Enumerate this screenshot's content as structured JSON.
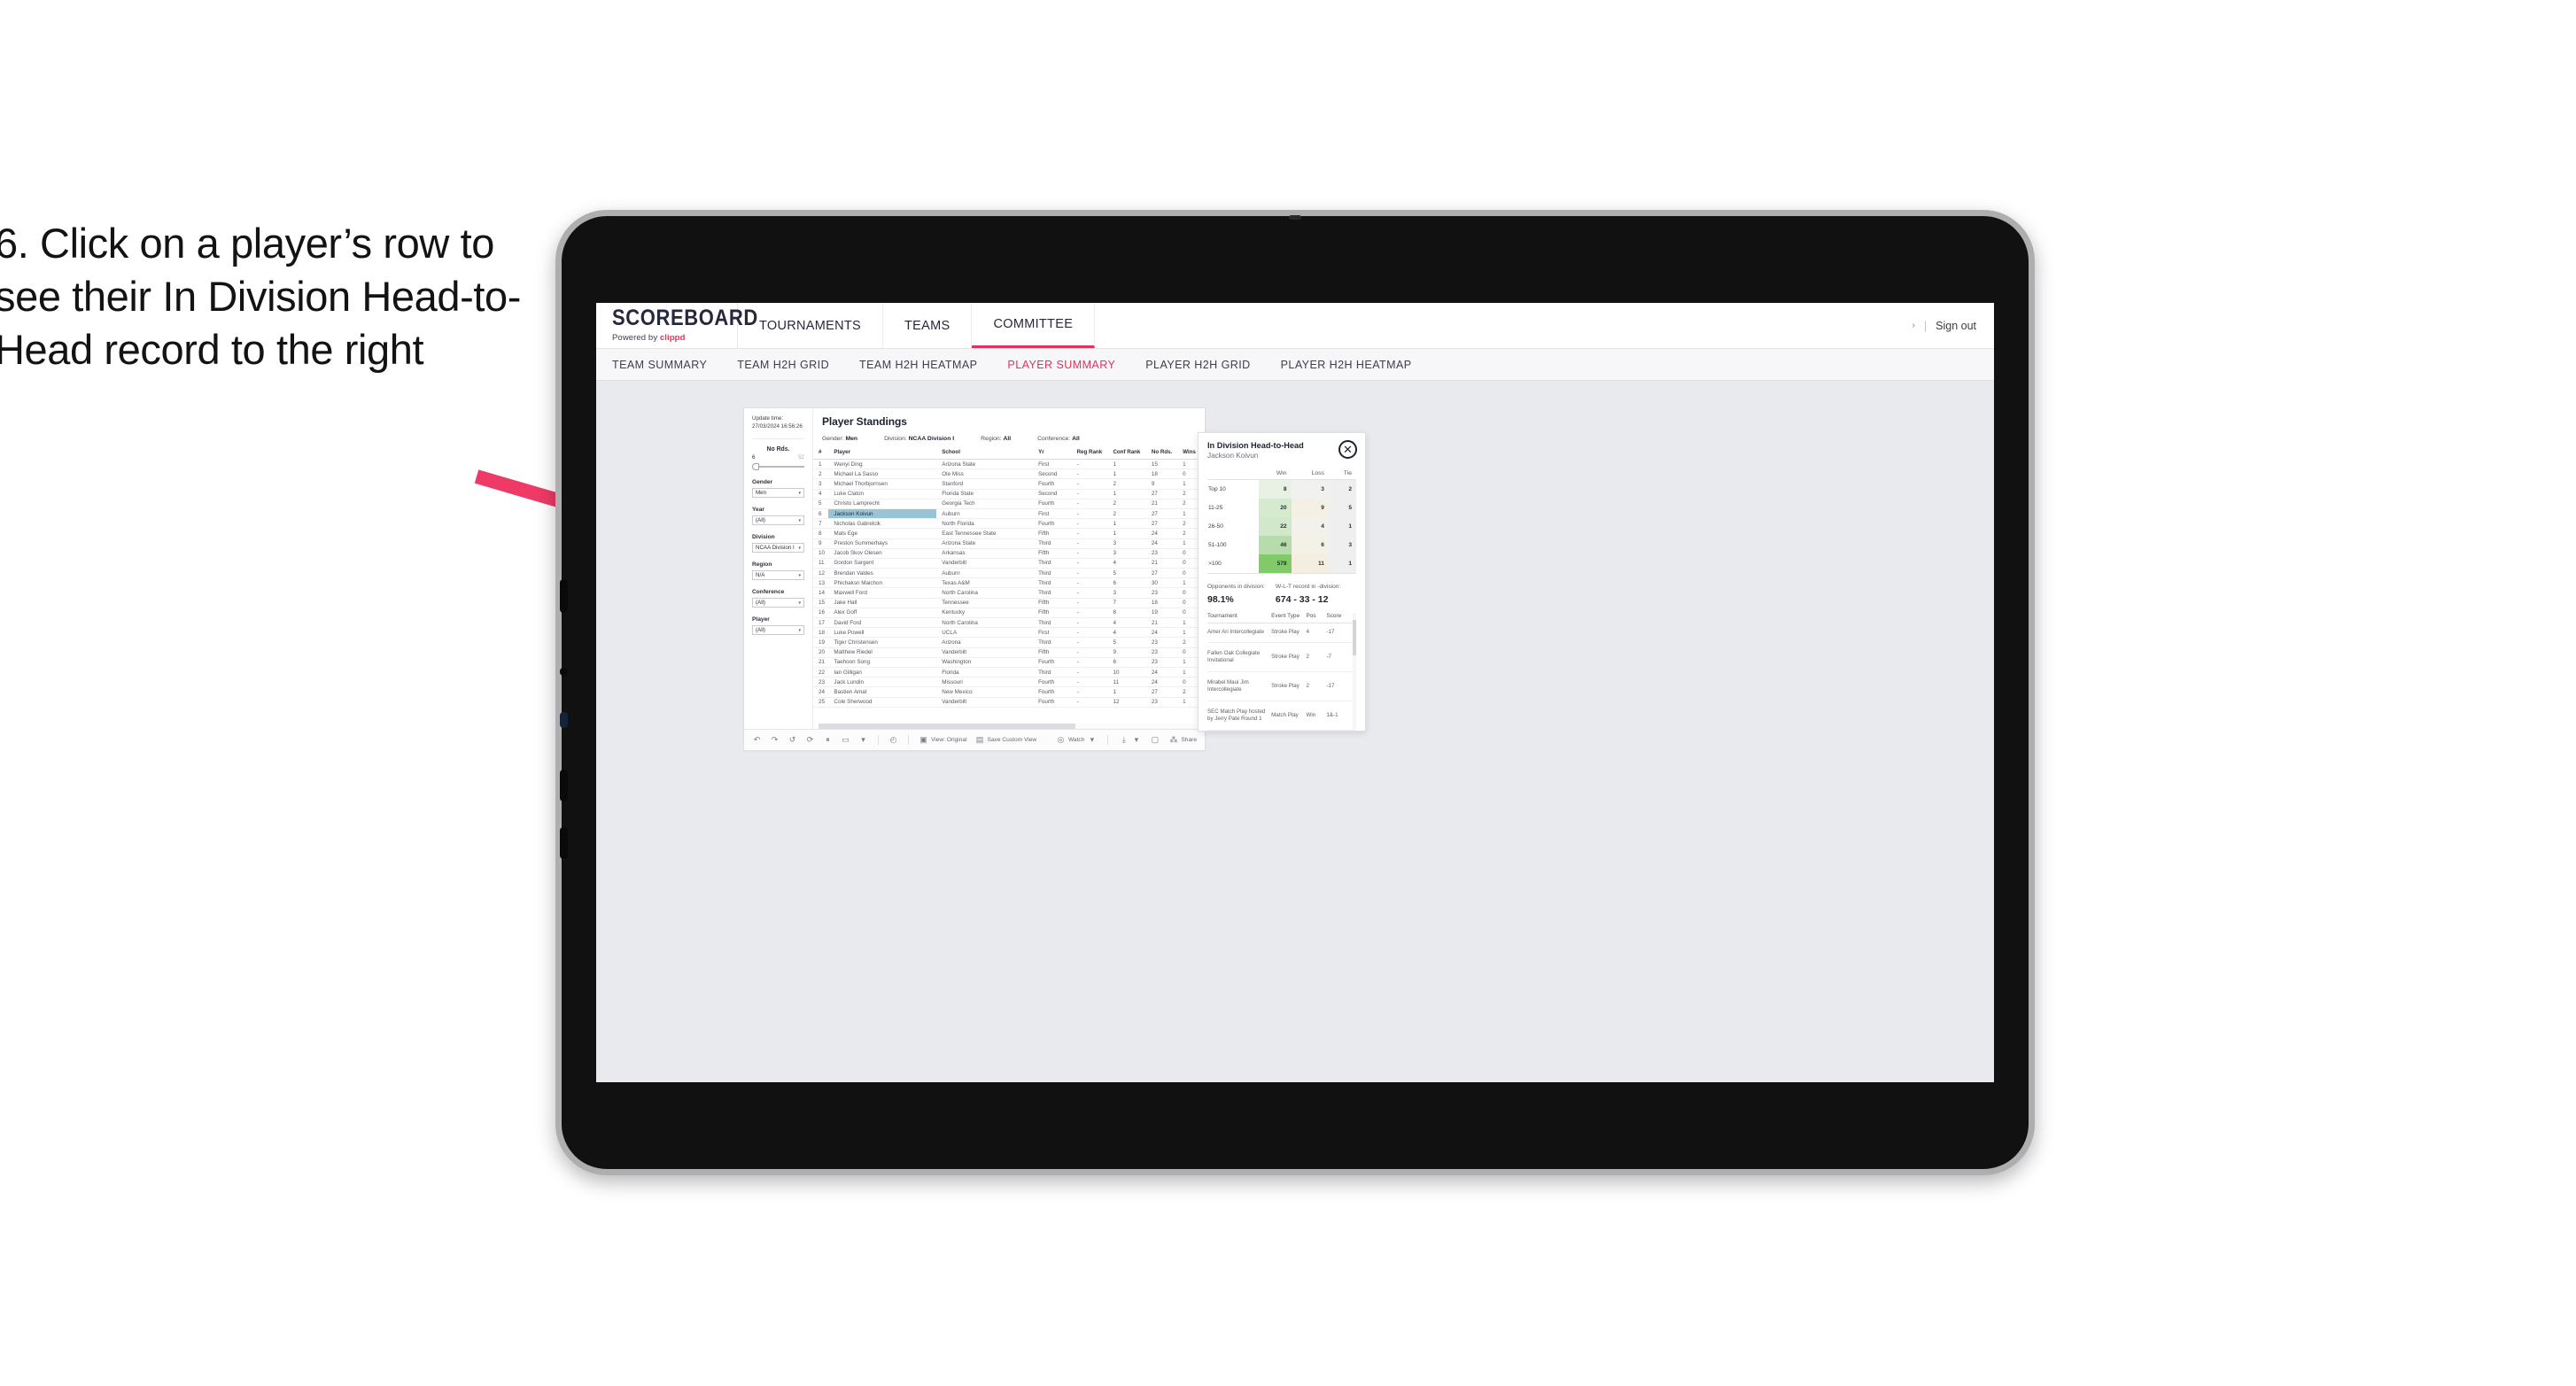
{
  "instruction": "6. Click on a player’s row to see their In Division Head-to-Head record to the right",
  "brand": {
    "title": "SCOREBOARD",
    "powered_prefix": "Powered by ",
    "powered_name": "clippd",
    "accent": "#e0335c"
  },
  "topnav": {
    "items": [
      {
        "label": "TOURNAMENTS",
        "active": false
      },
      {
        "label": "TEAMS",
        "active": false
      },
      {
        "label": "COMMITTEE",
        "active": true
      }
    ],
    "chevron": "›",
    "separator": "|",
    "signout": "Sign out"
  },
  "subnav": {
    "items": [
      {
        "label": "TEAM SUMMARY",
        "active": false
      },
      {
        "label": "TEAM H2H GRID",
        "active": false
      },
      {
        "label": "TEAM H2H HEATMAP",
        "active": false
      },
      {
        "label": "PLAYER SUMMARY",
        "active": true
      },
      {
        "label": "PLAYER H2H GRID",
        "active": false
      },
      {
        "label": "PLAYER H2H HEATMAP",
        "active": false
      }
    ]
  },
  "filters": {
    "update_label": "Update time:",
    "update_value": "27/03/2024 16:56:26",
    "slider": {
      "title": "No Rds.",
      "min": "6",
      "max": "52"
    },
    "selects": [
      {
        "title": "Gender",
        "value": "Men"
      },
      {
        "title": "Year",
        "value": "(All)"
      },
      {
        "title": "Division",
        "value": "NCAA Division I"
      },
      {
        "title": "Region",
        "value": "N/A"
      },
      {
        "title": "Conference",
        "value": "(All)"
      },
      {
        "title": "Player",
        "value": "(All)"
      }
    ],
    "caret": "▾"
  },
  "standings": {
    "title": "Player Standings",
    "summary": [
      {
        "label": "Gender: ",
        "value": "Men"
      },
      {
        "label": "Division: ",
        "value": "NCAA Division I"
      },
      {
        "label": "Region: ",
        "value": "All"
      },
      {
        "label": "Conference: ",
        "value": "All"
      }
    ],
    "columns": [
      "#",
      "Player",
      "School",
      "Yr",
      "Reg Rank",
      "Conf Rank",
      "No Rds.",
      "Wins"
    ],
    "rows": [
      {
        "rank": "1",
        "player": "Wenyi Ding",
        "school": "Arizona State",
        "yr": "First",
        "reg": "-",
        "conf": "1",
        "rds": "15",
        "wins": "1",
        "selected": false
      },
      {
        "rank": "2",
        "player": "Michael La Sasso",
        "school": "Ole Miss",
        "yr": "Second",
        "reg": "-",
        "conf": "1",
        "rds": "18",
        "wins": "0",
        "selected": false
      },
      {
        "rank": "3",
        "player": "Michael Thorbjornsen",
        "school": "Stanford",
        "yr": "Fourth",
        "reg": "-",
        "conf": "2",
        "rds": "9",
        "wins": "1",
        "selected": false
      },
      {
        "rank": "4",
        "player": "Luke Claton",
        "school": "Florida State",
        "yr": "Second",
        "reg": "-",
        "conf": "1",
        "rds": "27",
        "wins": "2",
        "selected": false
      },
      {
        "rank": "5",
        "player": "Christo Lamprecht",
        "school": "Georgia Tech",
        "yr": "Fourth",
        "reg": "-",
        "conf": "2",
        "rds": "21",
        "wins": "2",
        "selected": false
      },
      {
        "rank": "6",
        "player": "Jackson Koivun",
        "school": "Auburn",
        "yr": "First",
        "reg": "-",
        "conf": "2",
        "rds": "27",
        "wins": "1",
        "selected": true
      },
      {
        "rank": "7",
        "player": "Nicholas Gabrelcik",
        "school": "North Florida",
        "yr": "Fourth",
        "reg": "-",
        "conf": "1",
        "rds": "27",
        "wins": "2",
        "selected": false
      },
      {
        "rank": "8",
        "player": "Mats Ege",
        "school": "East Tennessee State",
        "yr": "Fifth",
        "reg": "-",
        "conf": "1",
        "rds": "24",
        "wins": "2",
        "selected": false
      },
      {
        "rank": "9",
        "player": "Preston Summerhays",
        "school": "Arizona State",
        "yr": "Third",
        "reg": "-",
        "conf": "3",
        "rds": "24",
        "wins": "1",
        "selected": false
      },
      {
        "rank": "10",
        "player": "Jacob Skov Olesen",
        "school": "Arkansas",
        "yr": "Fifth",
        "reg": "-",
        "conf": "3",
        "rds": "23",
        "wins": "0",
        "selected": false
      },
      {
        "rank": "11",
        "player": "Gordon Sargent",
        "school": "Vanderbilt",
        "yr": "Third",
        "reg": "-",
        "conf": "4",
        "rds": "21",
        "wins": "0",
        "selected": false
      },
      {
        "rank": "12",
        "player": "Brendan Valdes",
        "school": "Auburn",
        "yr": "Third",
        "reg": "-",
        "conf": "5",
        "rds": "27",
        "wins": "0",
        "selected": false
      },
      {
        "rank": "13",
        "player": "Phichaksn Maichon",
        "school": "Texas A&M",
        "yr": "Third",
        "reg": "-",
        "conf": "6",
        "rds": "30",
        "wins": "1",
        "selected": false
      },
      {
        "rank": "14",
        "player": "Maxwell Ford",
        "school": "North Carolina",
        "yr": "Third",
        "reg": "-",
        "conf": "3",
        "rds": "23",
        "wins": "0",
        "selected": false
      },
      {
        "rank": "15",
        "player": "Jake Hall",
        "school": "Tennessee",
        "yr": "Fifth",
        "reg": "-",
        "conf": "7",
        "rds": "18",
        "wins": "0",
        "selected": false
      },
      {
        "rank": "16",
        "player": "Alex Goff",
        "school": "Kentucky",
        "yr": "Fifth",
        "reg": "-",
        "conf": "8",
        "rds": "19",
        "wins": "0",
        "selected": false
      },
      {
        "rank": "17",
        "player": "David Ford",
        "school": "North Carolina",
        "yr": "Third",
        "reg": "-",
        "conf": "4",
        "rds": "21",
        "wins": "1",
        "selected": false
      },
      {
        "rank": "18",
        "player": "Luke Powell",
        "school": "UCLA",
        "yr": "First",
        "reg": "-",
        "conf": "4",
        "rds": "24",
        "wins": "1",
        "selected": false
      },
      {
        "rank": "19",
        "player": "Tiger Christensen",
        "school": "Arizona",
        "yr": "Third",
        "reg": "-",
        "conf": "5",
        "rds": "23",
        "wins": "2",
        "selected": false
      },
      {
        "rank": "20",
        "player": "Matthew Riedel",
        "school": "Vanderbilt",
        "yr": "Fifth",
        "reg": "-",
        "conf": "9",
        "rds": "23",
        "wins": "0",
        "selected": false
      },
      {
        "rank": "21",
        "player": "Taehoon Song",
        "school": "Washington",
        "yr": "Fourth",
        "reg": "-",
        "conf": "6",
        "rds": "23",
        "wins": "1",
        "selected": false
      },
      {
        "rank": "22",
        "player": "Ian Gilligan",
        "school": "Florida",
        "yr": "Third",
        "reg": "-",
        "conf": "10",
        "rds": "24",
        "wins": "1",
        "selected": false
      },
      {
        "rank": "23",
        "player": "Jack Lundin",
        "school": "Missouri",
        "yr": "Fourth",
        "reg": "-",
        "conf": "11",
        "rds": "24",
        "wins": "0",
        "selected": false
      },
      {
        "rank": "24",
        "player": "Bastien Amat",
        "school": "New Mexico",
        "yr": "Fourth",
        "reg": "-",
        "conf": "1",
        "rds": "27",
        "wins": "2",
        "selected": false
      },
      {
        "rank": "25",
        "player": "Cole Sherwood",
        "school": "Vanderbilt",
        "yr": "Fourth",
        "reg": "-",
        "conf": "12",
        "rds": "23",
        "wins": "1",
        "selected": false
      }
    ]
  },
  "detail": {
    "title": "In Division Head-to-Head",
    "subtitle": "Jackson Koivun",
    "close_icon": "✕",
    "h2h": {
      "columns": [
        "",
        "Win",
        "Loss",
        "Tie"
      ],
      "rows": [
        {
          "bucket": "Top 10",
          "win": "8",
          "loss": "3",
          "tie": "2",
          "win_color": "#e8f2e4",
          "loss_color": "#f1f1ef",
          "tie_color": "#efefef"
        },
        {
          "bucket": "11-25",
          "win": "20",
          "loss": "9",
          "tie": "5",
          "win_color": "#d6ead0",
          "loss_color": "#f4f1e4",
          "tie_color": "#efefef"
        },
        {
          "bucket": "26-50",
          "win": "22",
          "loss": "4",
          "tie": "1",
          "win_color": "#d2e8cb",
          "loss_color": "#f2f1ec",
          "tie_color": "#efefef"
        },
        {
          "bucket": "51-100",
          "win": "46",
          "loss": "6",
          "tie": "3",
          "win_color": "#b6dcac",
          "loss_color": "#f4f1e6",
          "tie_color": "#efefef"
        },
        {
          "bucket": ">100",
          "win": "578",
          "loss": "11",
          "tie": "1",
          "win_color": "#81ca6a",
          "loss_color": "#f3eedf",
          "tie_color": "#efefef"
        }
      ]
    },
    "kpis": [
      {
        "label": "Opponents in division:",
        "value": "98.1%"
      },
      {
        "label": "W-L-T record in -division:",
        "value": "674 - 33 - 12"
      }
    ],
    "tournaments": {
      "columns": [
        "Tournament",
        "Event Type",
        "Pos",
        "Score"
      ],
      "rows": [
        {
          "name": "Amer Ari Intercollegiate",
          "type": "Stroke Play",
          "pos": "4",
          "score": "-17"
        },
        {
          "name": "Fallen Oak Collegiate Invitational",
          "type": "Stroke Play",
          "pos": "2",
          "score": "-7"
        },
        {
          "name": "Mirabel Maui Jim Intercollegiate",
          "type": "Stroke Play",
          "pos": "2",
          "score": "-17"
        },
        {
          "name": "SEC Match Play hosted by Jerry Pate Round 1",
          "type": "Match Play",
          "pos": "Win",
          "score": "1&-1"
        }
      ]
    }
  },
  "toolbar": {
    "icons": [
      "undo-icon",
      "redo-icon",
      "revert-icon",
      "refresh-data-icon",
      "pause-icon",
      "highlight-icon",
      "dropdown-caret"
    ],
    "glyphs": {
      "undo": "↶",
      "redo": "↷",
      "revert": "↺",
      "refresh": "⟳",
      "pause": "⏸",
      "highlight": "▭",
      "caret": "▾",
      "clock": "◴"
    },
    "view_label": "View: Original",
    "save_label": "Save Custom View",
    "watch_label": "Watch",
    "share_label": "Share",
    "download_glyph": "⤓",
    "device_glyph": "▢",
    "share_glyph": "⁂",
    "watch_glyph": "◎"
  }
}
